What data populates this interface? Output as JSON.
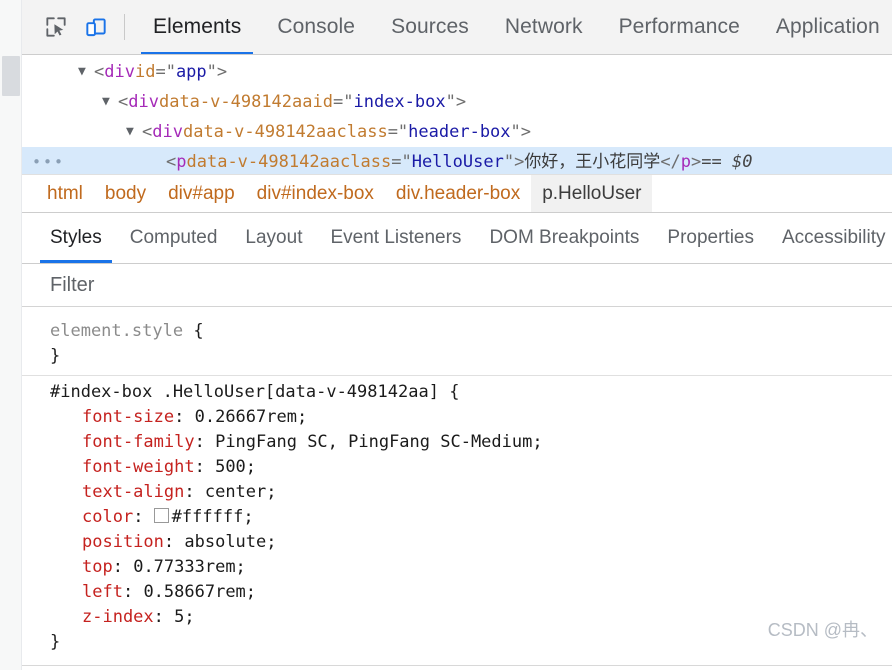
{
  "toolbar": {
    "inspect_icon": "inspect-cursor-icon",
    "device_icon": "device-toolbar-icon",
    "tabs": [
      {
        "label": "Elements",
        "active": true
      },
      {
        "label": "Console",
        "active": false
      },
      {
        "label": "Sources",
        "active": false
      },
      {
        "label": "Network",
        "active": false
      },
      {
        "label": "Performance",
        "active": false
      },
      {
        "label": "Application",
        "active": false
      }
    ],
    "active_accent": "#1a73e8"
  },
  "dom_tree": {
    "rows": [
      {
        "indent": 56,
        "twisty": "▼",
        "selected": false,
        "ellipsis": "",
        "parts": [
          {
            "t": "punc",
            "s": "<"
          },
          {
            "t": "tag",
            "s": "div"
          },
          {
            "t": "punc",
            "s": " "
          },
          {
            "t": "attr",
            "s": "id"
          },
          {
            "t": "punc",
            "s": "=\""
          },
          {
            "t": "val",
            "s": "app"
          },
          {
            "t": "punc",
            "s": "\">"
          }
        ]
      },
      {
        "indent": 80,
        "twisty": "▼",
        "selected": false,
        "ellipsis": "",
        "parts": [
          {
            "t": "punc",
            "s": "<"
          },
          {
            "t": "tag",
            "s": "div"
          },
          {
            "t": "punc",
            "s": " "
          },
          {
            "t": "attr",
            "s": "data-v-498142aa"
          },
          {
            "t": "punc",
            "s": " "
          },
          {
            "t": "attr",
            "s": "id"
          },
          {
            "t": "punc",
            "s": "=\""
          },
          {
            "t": "val",
            "s": "index-box"
          },
          {
            "t": "punc",
            "s": "\">"
          }
        ]
      },
      {
        "indent": 104,
        "twisty": "▼",
        "selected": false,
        "ellipsis": "",
        "parts": [
          {
            "t": "punc",
            "s": "<"
          },
          {
            "t": "tag",
            "s": "div"
          },
          {
            "t": "punc",
            "s": " "
          },
          {
            "t": "attr",
            "s": "data-v-498142aa"
          },
          {
            "t": "punc",
            "s": " "
          },
          {
            "t": "attr",
            "s": "class"
          },
          {
            "t": "punc",
            "s": "=\""
          },
          {
            "t": "val",
            "s": "header-box"
          },
          {
            "t": "punc",
            "s": "\">"
          }
        ]
      },
      {
        "indent": 128,
        "twisty": "",
        "selected": true,
        "ellipsis": "•••",
        "parts": [
          {
            "t": "punc",
            "s": "<"
          },
          {
            "t": "tag",
            "s": "p"
          },
          {
            "t": "punc",
            "s": " "
          },
          {
            "t": "attr",
            "s": "data-v-498142aa"
          },
          {
            "t": "punc",
            "s": " "
          },
          {
            "t": "attr",
            "s": "class"
          },
          {
            "t": "punc",
            "s": "=\""
          },
          {
            "t": "val",
            "s": "HelloUser"
          },
          {
            "t": "punc",
            "s": "\">"
          },
          {
            "t": "txt",
            "s": "你好，王小花同学"
          },
          {
            "t": "punc",
            "s": "</"
          },
          {
            "t": "tag",
            "s": "p"
          },
          {
            "t": "punc",
            "s": ">"
          },
          {
            "t": "eq0",
            "s": "  == $0"
          }
        ]
      }
    ]
  },
  "breadcrumbs": [
    {
      "label": "html",
      "style": "alt",
      "selected": false
    },
    {
      "label": "body",
      "style": "alt",
      "selected": false
    },
    {
      "label": "div#app",
      "style": "alt",
      "selected": false
    },
    {
      "label": "div#index-box",
      "style": "alt",
      "selected": false
    },
    {
      "label": "div.header-box",
      "style": "alt",
      "selected": false
    },
    {
      "label": "p.HelloUser",
      "style": "plain",
      "selected": true
    }
  ],
  "pane_tabs": [
    {
      "label": "Styles",
      "active": true
    },
    {
      "label": "Computed",
      "active": false
    },
    {
      "label": "Layout",
      "active": false
    },
    {
      "label": "Event Listeners",
      "active": false
    },
    {
      "label": "DOM Breakpoints",
      "active": false
    },
    {
      "label": "Properties",
      "active": false
    },
    {
      "label": "Accessibility",
      "active": false
    }
  ],
  "filter": {
    "placeholder": "Filter",
    "value": ""
  },
  "styles": {
    "element_style": {
      "selector": "element.style",
      "open_brace": "{",
      "close_brace": "}"
    },
    "rule": {
      "selector": "#index-box .HelloUser[data-v-498142aa]",
      "open_brace": "{",
      "close_brace": "}",
      "declarations": [
        {
          "prop": "font-size",
          "value": "0.26667rem;",
          "swatch": false
        },
        {
          "prop": "font-family",
          "value": "PingFang SC, PingFang SC-Medium;",
          "swatch": false
        },
        {
          "prop": "font-weight",
          "value": "500;",
          "swatch": false
        },
        {
          "prop": "text-align",
          "value": "center;",
          "swatch": false
        },
        {
          "prop": "color",
          "value": "#ffffff;",
          "swatch": true,
          "swatch_color": "#ffffff"
        },
        {
          "prop": "position",
          "value": "absolute;",
          "swatch": false
        },
        {
          "prop": "top",
          "value": "0.77333rem;",
          "swatch": false
        },
        {
          "prop": "left",
          "value": "0.58667rem;",
          "swatch": false
        },
        {
          "prop": "z-index",
          "value": "5;",
          "swatch": false
        }
      ]
    }
  },
  "watermark": "CSDN @冉、"
}
